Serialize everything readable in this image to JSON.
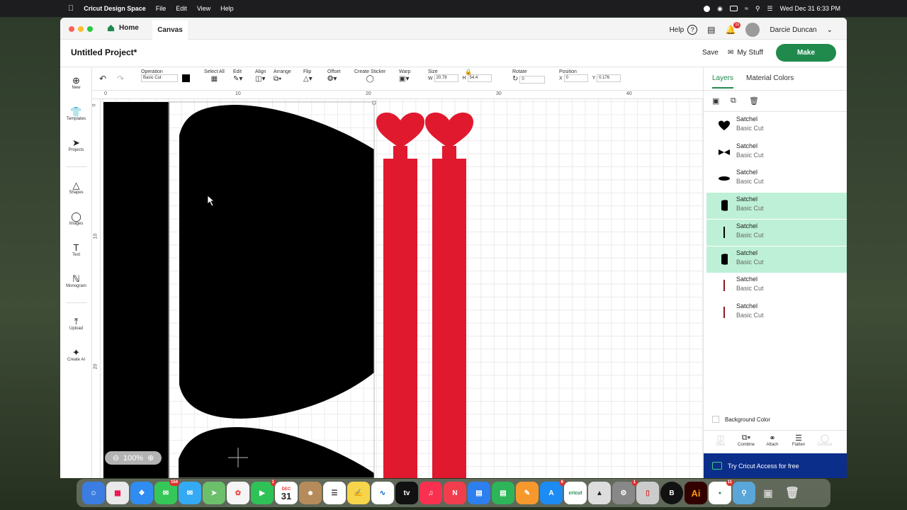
{
  "menubar": {
    "app_name": "Cricut Design Space",
    "menus": [
      "File",
      "Edit",
      "View",
      "Help"
    ],
    "datetime": "Wed Dec 31  6:33 PM"
  },
  "titlebar": {
    "home_label": "Home",
    "canvas_label": "Canvas",
    "help_label": "Help",
    "notifications_count": "11",
    "user_name": "Darcie Duncan"
  },
  "header": {
    "project_title": "Untitled Project*",
    "save_label": "Save",
    "mystuff_label": "My Stuff",
    "make_label": "Make"
  },
  "toolbar": {
    "operation_label": "Operation",
    "operation_value": "Basic Cut",
    "selectall_label": "Select All",
    "edit_label": "Edit",
    "align_label": "Align",
    "arrange_label": "Arrange",
    "flip_label": "Flip",
    "offset_label": "Offset",
    "sticker_label": "Create Sticker",
    "warp_label": "Warp",
    "size_label": "Size",
    "w_label": "W",
    "w_value": "20.78",
    "h_label": "H",
    "h_value": "54.4",
    "rotate_label": "Rotate",
    "rotate_value": "0",
    "position_label": "Position",
    "x_label": "X",
    "x_value": "0",
    "y_label": "Y",
    "y_value": "0.176"
  },
  "sidebar": {
    "items": [
      {
        "label": "New",
        "icon": "plus-circle-icon"
      },
      {
        "label": "Templates",
        "icon": "shirt-icon"
      },
      {
        "label": "Projects",
        "icon": "rocket-icon"
      },
      {
        "label": "Shapes",
        "icon": "shapes-icon"
      },
      {
        "label": "Images",
        "icon": "lightbulb-icon"
      },
      {
        "label": "Text",
        "icon": "text-icon"
      },
      {
        "label": "Monogram",
        "icon": "monogram-icon"
      },
      {
        "label": "Upload",
        "icon": "upload-icon"
      },
      {
        "label": "Create AI",
        "icon": "sparkle-icon"
      }
    ]
  },
  "canvas": {
    "ruler_top": [
      "0",
      "10",
      "20",
      "30",
      "40"
    ],
    "ruler_left": [
      "0",
      "10",
      "20"
    ],
    "zoom": "100%"
  },
  "right_panel": {
    "tab_layers": "Layers",
    "tab_material": "Material Colors",
    "layers": [
      {
        "name": "Satchel",
        "op": "Basic Cut",
        "selected": false,
        "thumb": "heart-black"
      },
      {
        "name": "Satchel",
        "op": "Basic Cut",
        "selected": false,
        "thumb": "bow-black"
      },
      {
        "name": "Satchel",
        "op": "Basic Cut",
        "selected": false,
        "thumb": "oval-black"
      },
      {
        "name": "Satchel",
        "op": "Basic Cut",
        "selected": true,
        "thumb": "panel-black"
      },
      {
        "name": "Satchel",
        "op": "Basic Cut",
        "selected": true,
        "thumb": "line-black"
      },
      {
        "name": "Satchel",
        "op": "Basic Cut",
        "selected": true,
        "thumb": "panel-black"
      },
      {
        "name": "Satchel",
        "op": "Basic Cut",
        "selected": false,
        "thumb": "line-red"
      },
      {
        "name": "Satchel",
        "op": "Basic Cut",
        "selected": false,
        "thumb": "line-red"
      }
    ],
    "background_color_label": "Background Color",
    "actions": [
      "Slice",
      "Combine",
      "Attach",
      "Flatten",
      "Contour"
    ],
    "access_label": "Try Cricut Access for free"
  },
  "dock": {
    "calendar_month": "DEC",
    "calendar_day": "31",
    "messages_badge": "154",
    "facetime_badge": "1",
    "appstore_badge": "6",
    "settings_badge": "1",
    "cricut_badge": "11",
    "cricut_label": "cricut",
    "ai_label": "Ai",
    "b_label": "B"
  },
  "colors": {
    "accent_green": "#1f8a4c",
    "selected_layer": "#bdf0d6",
    "strap_red": "#e0192f",
    "shape_black": "#000000",
    "access_blue": "#0b2e8a"
  }
}
